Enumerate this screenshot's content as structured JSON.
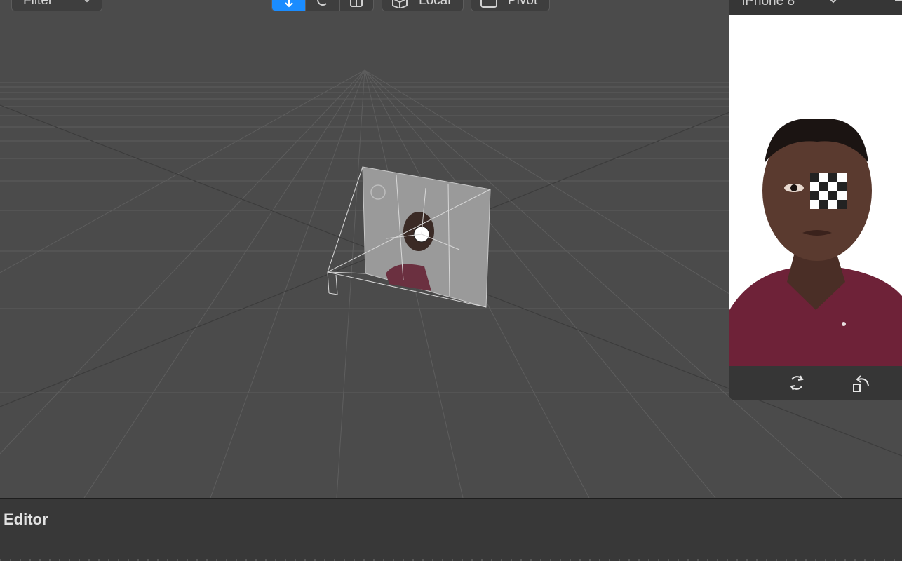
{
  "toolbar": {
    "filter_label": "Filter",
    "local_label": "Local",
    "pivot_label": "Pivot",
    "transform_tools": [
      "move",
      "rotate",
      "scale"
    ],
    "active_tool": "move",
    "accent_color": "#1a8cff"
  },
  "simulator": {
    "device_label": "iPhone 8",
    "rotate_icon": "rotate-icon",
    "reset_icon": "reset-orientation-icon"
  },
  "editor": {
    "title": "Editor"
  },
  "colors": {
    "viewport_bg": "#4b4b4b",
    "panel_bg": "#383838",
    "simulator_bg": "#363636"
  }
}
